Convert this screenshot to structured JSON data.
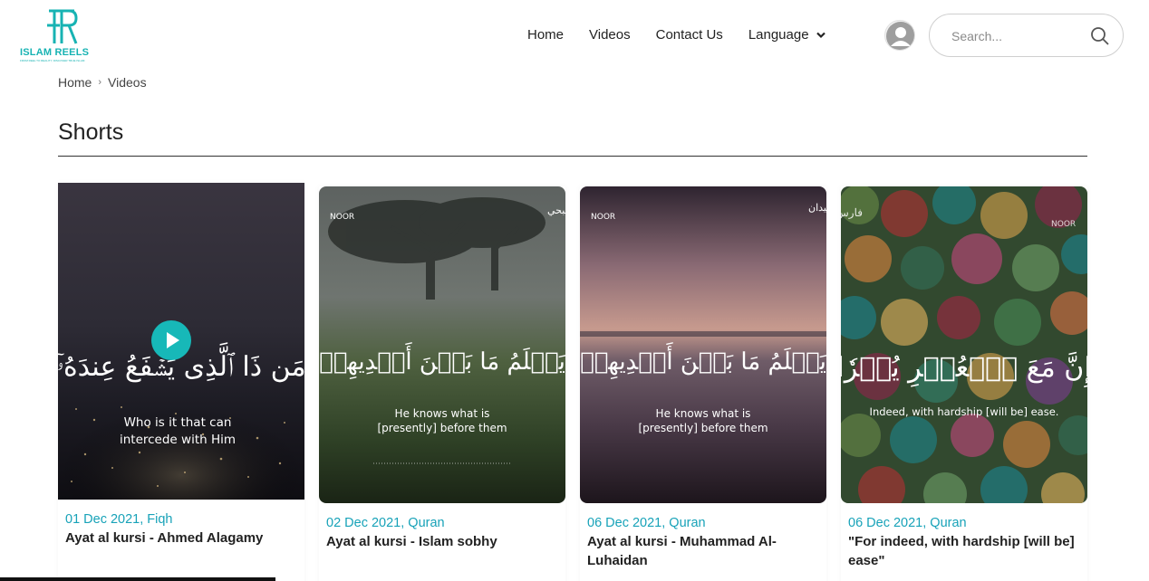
{
  "brand": {
    "name": "ISLAM REELS",
    "tagline": "FROM REEL TO REALITY, DISCOVER TRUE ISLAM"
  },
  "nav": {
    "items": [
      "Home",
      "Videos",
      "Contact Us"
    ],
    "language_label": "Language"
  },
  "search": {
    "placeholder": "Search..."
  },
  "breadcrumb": {
    "home": "Home",
    "current": "Videos"
  },
  "section": {
    "title": "Shorts"
  },
  "colors": {
    "accent": "#17b3b3",
    "meta": "#17a2b8"
  },
  "videos": [
    {
      "meta": "01 Dec 2021, Fiqh",
      "title": "Ayat al kursi - Ahmed Alagamy",
      "arabic": "مَن ذَا ٱلَّذِى يَشۡفَعُ عِندَهُۥٓ",
      "caption_line1": "Who is it that can",
      "caption_line2": "intercede with Him",
      "reciter": ""
    },
    {
      "meta": "02 Dec 2021, Quran",
      "title": "Ayat al kursi - Islam sobhy",
      "arabic": "يَعۡلَمُ مَا بَيۡنَ أَيۡدِيهِمۡ",
      "caption_line1": "He knows what is",
      "caption_line2": "[presently] before them",
      "reciter": "إسلام صبحي",
      "badge": "NOOR"
    },
    {
      "meta": "06 Dec 2021, Quran",
      "title": "Ayat al kursi - Muhammad Al-Luhaidan",
      "arabic": "يَعۡلَمُ مَا بَيۡنَ أَيۡدِيهِمۡ",
      "caption_line1": "He knows what is",
      "caption_line2": "[presently] before them",
      "reciter": "محمد اللحيدان",
      "badge": "NOOR"
    },
    {
      "meta": "06 Dec 2021, Quran",
      "title": "\"For indeed, with hardship [will be] ease\"",
      "arabic": "إِنَّ مَعَ ٱلۡعُسۡرِ يُسۡرٗا",
      "caption_line1": "Indeed, with hardship [will be] ease.",
      "caption_line2": "",
      "reciter": "فارس عباد",
      "badge": "NOOR"
    }
  ]
}
